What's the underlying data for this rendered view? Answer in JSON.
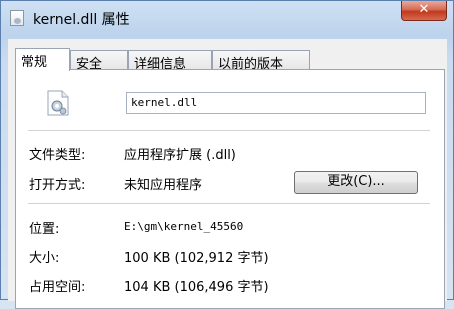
{
  "window": {
    "title": "kernel.dll 属性",
    "close_label": "✕"
  },
  "tabs": [
    {
      "label": "常规"
    },
    {
      "label": "安全"
    },
    {
      "label": "详细信息"
    },
    {
      "label": "以前的版本"
    }
  ],
  "general": {
    "file_name": "kernel.dll",
    "file_type_label": "文件类型:",
    "file_type_value": "应用程序扩展 (.dll)",
    "opens_with_label": "打开方式:",
    "opens_with_value": "未知应用程序",
    "change_button": "更改(C)...",
    "location_label": "位置:",
    "location_value": "E:\\gm\\kernel_45560",
    "size_label": "大小:",
    "size_value": "100 KB (102,912 字节)",
    "size_on_disk_label": "占用空间:",
    "size_on_disk_value": "104 KB (106,496 字节)"
  },
  "icons": {
    "app": "file-properties-icon",
    "file": "dll-gear-file-icon"
  }
}
